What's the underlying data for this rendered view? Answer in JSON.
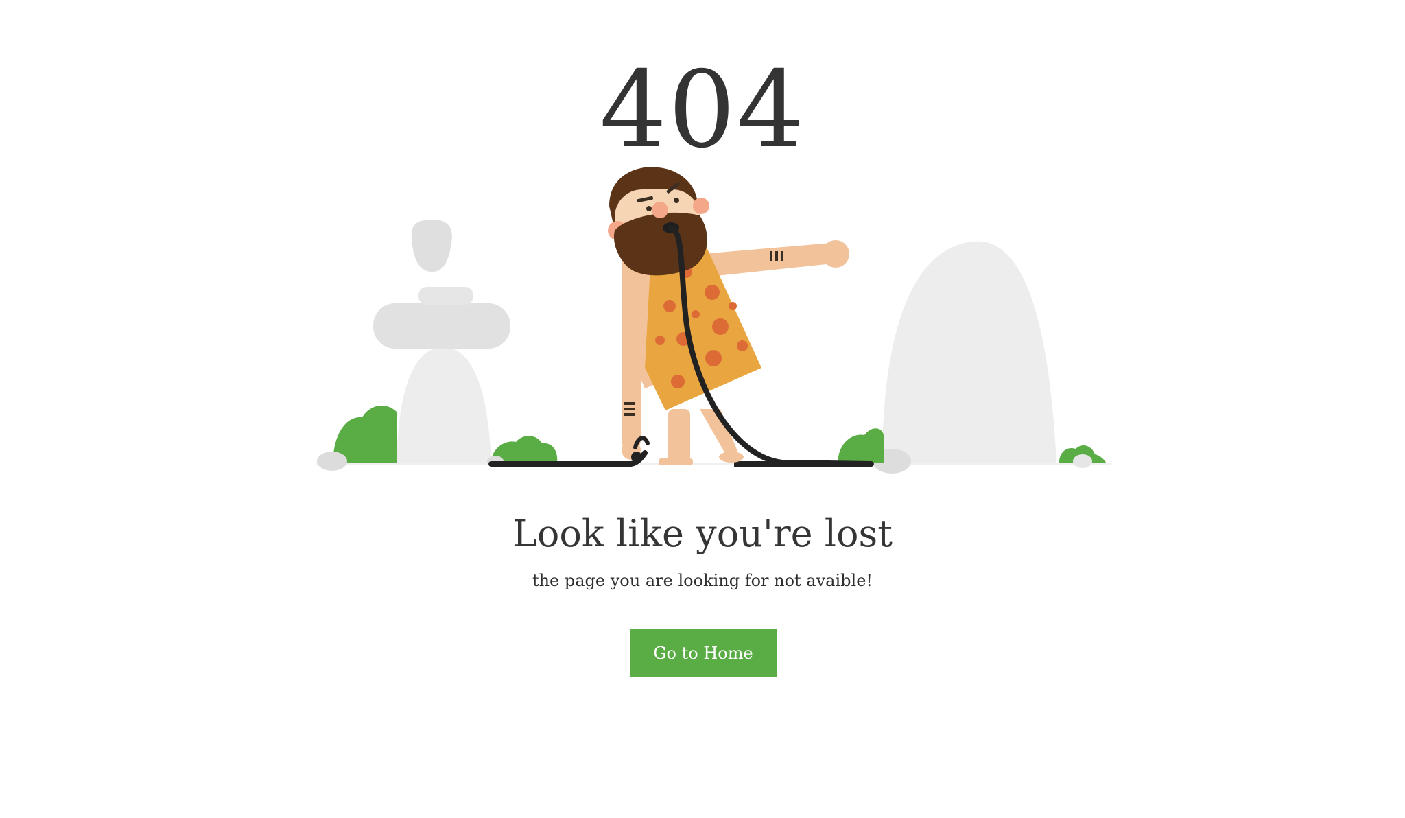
{
  "error": {
    "code": "404"
  },
  "message": {
    "headline": "Look like you're lost",
    "subtitle": "the page you are looking for not avaible!"
  },
  "actions": {
    "home_label": "Go to Home"
  },
  "colors": {
    "accent": "#5aac45",
    "rock": "#e8e8e8",
    "text": "#343434"
  }
}
